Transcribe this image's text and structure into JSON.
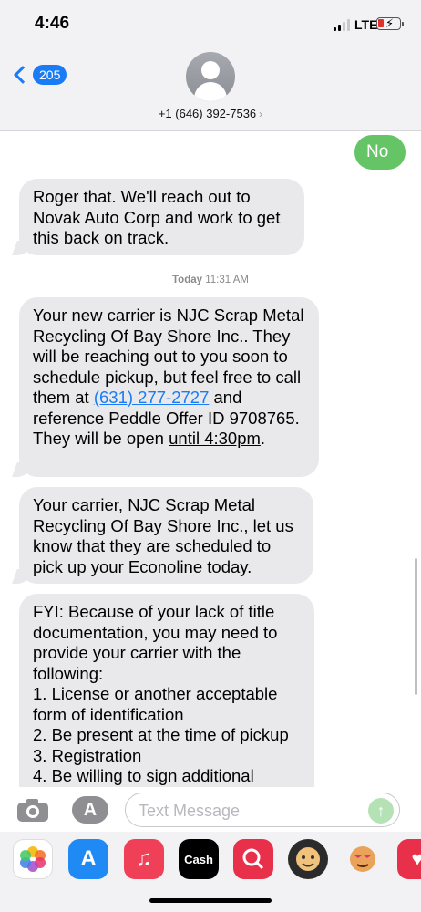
{
  "status_bar": {
    "time": "4:46",
    "network": "LTE"
  },
  "header": {
    "back_count": "205",
    "contact": "+1 (646) 392-7536"
  },
  "messages": {
    "m1": "No",
    "m2": "Roger that. We'll reach out to Novak Auto Corp and work to get this back on track.",
    "timestamp_day": "Today",
    "timestamp_time": "11:31 AM",
    "m3_a": "Your new carrier is NJC Scrap Metal Recycling Of Bay Shore Inc.. They will be reaching out to you soon to schedule pickup, but feel free to call them at ",
    "m3_phone": "(631) 277-2727",
    "m3_b": " and reference Peddle Offer ID 9708765. They will be open ",
    "m3_time": "until 4:30pm",
    "m3_c": ".",
    "m4": "Your carrier, NJC Scrap Metal Recycling Of Bay Shore Inc., let us know that they are scheduled to pick up your Econoline today.",
    "m5_lines": [
      "FYI: Because of your lack of title",
      "documentation, you may need to",
      "provide your carrier with the",
      "following:",
      "1. License or another acceptable",
      "form of identification",
      "2. Be present at the time of pickup",
      "3. Registration",
      "4. Be willing to sign additional"
    ]
  },
  "input": {
    "placeholder": "Text Message"
  },
  "app_strip": {
    "cash_label": "Cash"
  },
  "colors": {
    "accent": "#1a7cf5",
    "outgoing": "#65c466",
    "incoming": "#e9e9eb"
  }
}
